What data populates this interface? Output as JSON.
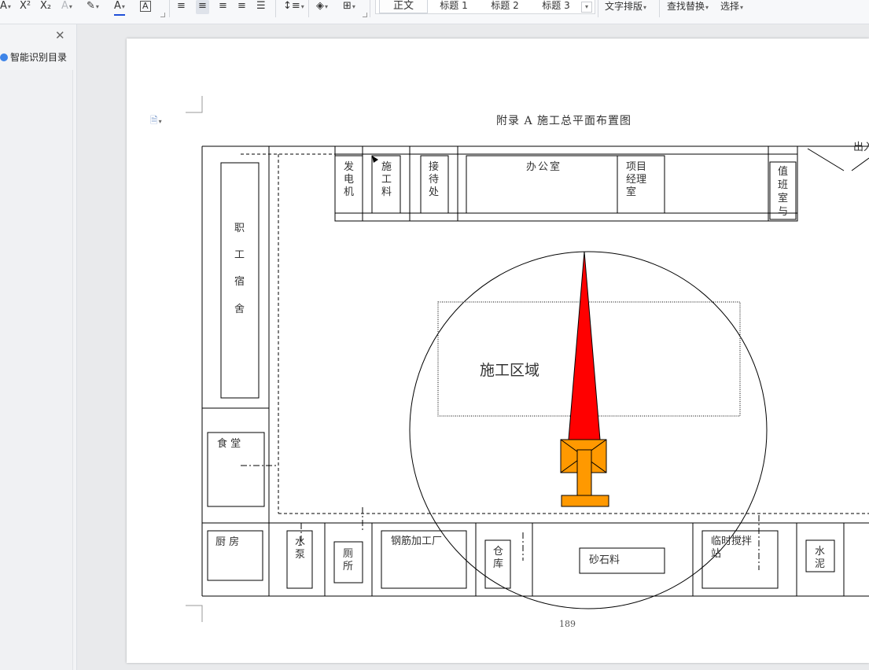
{
  "toolbar": {
    "superscript_label": "X²",
    "subscript_label": "X₂",
    "char_border_label": "A",
    "style_gallery": [
      "正文",
      "标题 1",
      "标题 2",
      "标题 3"
    ],
    "text_layout_label": "文字排版",
    "find_replace_label": "查找替换",
    "select_label": "选择"
  },
  "nav": {
    "title": "智能识别目录"
  },
  "document": {
    "title": "附录 A 施工总平面布置图",
    "page_number": "189",
    "rooms": {
      "dormitory": [
        "职",
        "工",
        "宿",
        "舍"
      ],
      "generator": [
        "发",
        "电",
        "机"
      ],
      "construction_material": [
        "施",
        "工",
        "料"
      ],
      "reception": [
        "接",
        "待",
        "处"
      ],
      "office": "办公室",
      "project_manager": [
        "项目",
        "经理",
        "室"
      ],
      "duty_room": [
        "值",
        "班",
        "室",
        "与"
      ],
      "exit": "出入",
      "construction_area": "施工区域",
      "canteen": "食 堂",
      "kitchen": "厨 房",
      "water_pump": [
        "水",
        "泵"
      ],
      "toilet": [
        "厕",
        "所"
      ],
      "rebar_shop": "钢筋加工厂",
      "warehouse": [
        "仓",
        "库"
      ],
      "sand_stone": "砂石料",
      "mixing_station": [
        "临时搅拌",
        "站"
      ],
      "cement": [
        "水",
        "泥"
      ]
    }
  },
  "colors": {
    "crane_mast": "#ff0000",
    "crane_base": "#ff9900",
    "accent_blue": "#3d84e8"
  }
}
